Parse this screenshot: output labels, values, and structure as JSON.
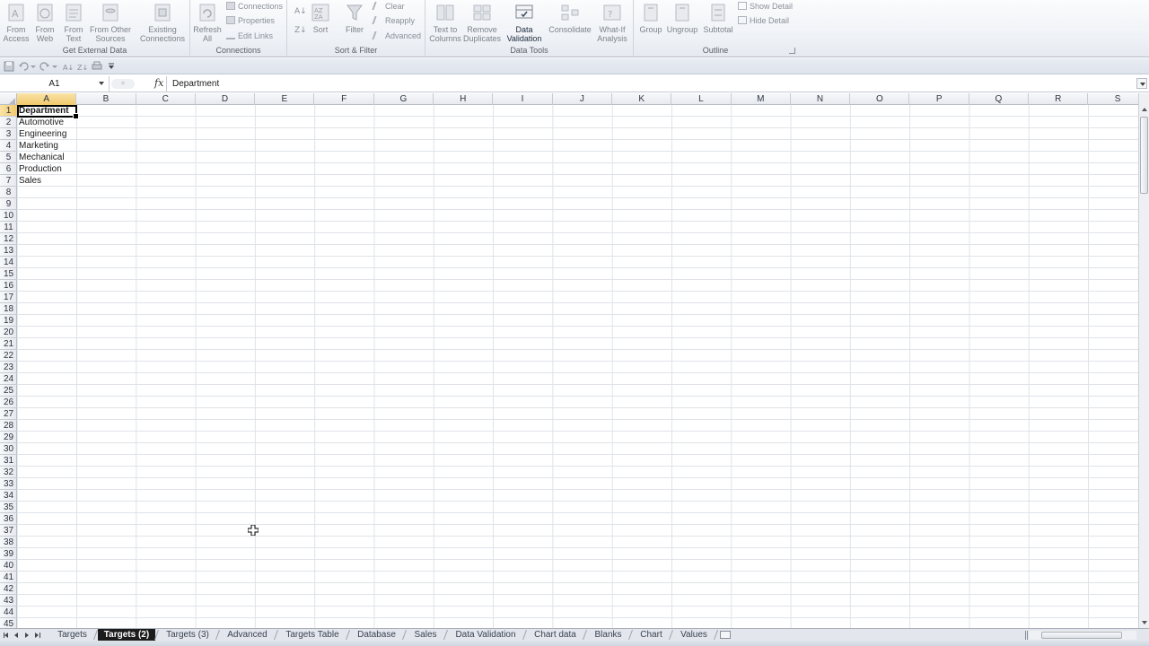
{
  "ribbon": {
    "groups": [
      {
        "label": "Get External Data"
      },
      {
        "label": "Connections"
      },
      {
        "label": "Sort & Filter"
      },
      {
        "label": "Data Tools"
      },
      {
        "label": "Outline"
      }
    ],
    "from_access": "From\nAccess",
    "from_web": "From\nWeb",
    "from_text": "From\nText",
    "from_other": "From Other\nSources",
    "existing_connections": "Existing\nConnections",
    "refresh_all": "Refresh\nAll",
    "connections": "Connections",
    "properties": "Properties",
    "edit_links": "Edit Links",
    "sort": "Sort",
    "filter": "Filter",
    "clear": "Clear",
    "reapply": "Reapply",
    "advanced": "Advanced",
    "text_to_columns": "Text to\nColumns",
    "remove_duplicates": "Remove\nDuplicates",
    "data_validation": "Data\nValidation",
    "consolidate": "Consolidate",
    "what_if": "What-If\nAnalysis",
    "group": "Group",
    "ungroup": "Ungroup",
    "subtotal": "Subtotal",
    "show_detail": "Show Detail",
    "hide_detail": "Hide Detail"
  },
  "formula_bar": {
    "name_box": "A1",
    "fx": "fx",
    "formula": "Department"
  },
  "columns": [
    "A",
    "B",
    "C",
    "D",
    "E",
    "F",
    "G",
    "H",
    "I",
    "J",
    "K",
    "L",
    "M",
    "N",
    "O",
    "P",
    "Q",
    "R",
    "S"
  ],
  "rows": [
    "1",
    "2",
    "3",
    "4",
    "5",
    "6",
    "7",
    "8",
    "9",
    "10",
    "11",
    "12",
    "13",
    "14",
    "15",
    "16",
    "17",
    "18",
    "19",
    "20",
    "21",
    "22",
    "23",
    "24",
    "25",
    "26",
    "27",
    "28",
    "29",
    "30",
    "31",
    "32",
    "33",
    "34",
    "35",
    "36",
    "37",
    "38",
    "39",
    "40",
    "41",
    "42",
    "43",
    "44",
    "45"
  ],
  "cells": {
    "A1": "Department",
    "A2": "Automotive",
    "A3": "Engineering",
    "A4": "Marketing",
    "A5": "Mechanical",
    "A6": "Production",
    "A7": "Sales"
  },
  "sheet_tabs": [
    "Targets",
    "Targets (2)",
    "Targets (3)",
    "Advanced",
    "Targets Table",
    "Database",
    "Sales",
    "Data Validation",
    "Chart data",
    "Blanks",
    "Chart",
    "Values"
  ],
  "active_tab": "Targets (2)",
  "colors": {
    "selected_header": "#f2c96c",
    "active_tab_bg": "#1c1c1c"
  }
}
